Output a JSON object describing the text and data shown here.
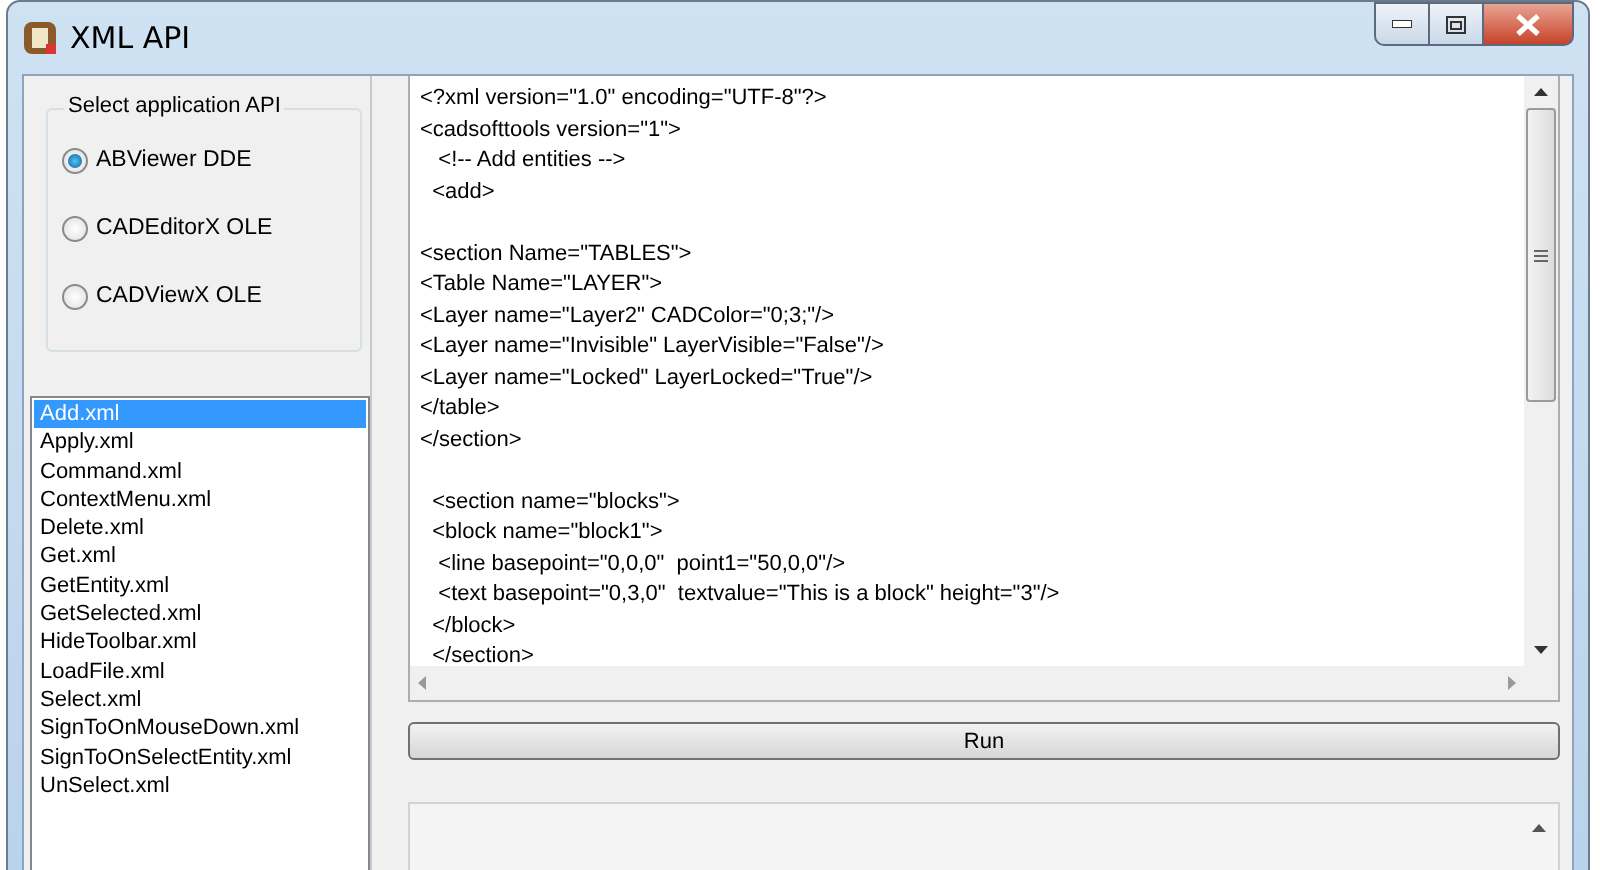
{
  "window": {
    "title": "XML API"
  },
  "api_group": {
    "title": "Select application API",
    "options": [
      {
        "label": "ABViewer DDE",
        "selected": true
      },
      {
        "label": "CADEditorX OLE",
        "selected": false
      },
      {
        "label": "CADViewX OLE",
        "selected": false
      }
    ]
  },
  "files": [
    {
      "label": "Add.xml",
      "selected": true
    },
    {
      "label": "Apply.xml",
      "selected": false
    },
    {
      "label": "Command.xml",
      "selected": false
    },
    {
      "label": "ContextMenu.xml",
      "selected": false
    },
    {
      "label": "Delete.xml",
      "selected": false
    },
    {
      "label": "Get.xml",
      "selected": false
    },
    {
      "label": "GetEntity.xml",
      "selected": false
    },
    {
      "label": "GetSelected.xml",
      "selected": false
    },
    {
      "label": "HideToolbar.xml",
      "selected": false
    },
    {
      "label": "LoadFile.xml",
      "selected": false
    },
    {
      "label": "Select.xml",
      "selected": false
    },
    {
      "label": "SignToOnMouseDown.xml",
      "selected": false
    },
    {
      "label": "SignToOnSelectEntity.xml",
      "selected": false
    },
    {
      "label": "UnSelect.xml",
      "selected": false
    }
  ],
  "editor": {
    "blocks": [
      [
        "<?xml version=\"1.0\" encoding=\"UTF-8\"?>",
        "<cadsofttools version=\"1\">",
        "   <!-- Add entities -->",
        "  <add>"
      ],
      [
        "<section Name=\"TABLES\">",
        "<Table Name=\"LAYER\">",
        "<Layer name=\"Layer2\" CADColor=\"0;3;\"/>",
        "<Layer name=\"Invisible\" LayerVisible=\"False\"/>",
        "<Layer name=\"Locked\" LayerLocked=\"True\"/>",
        "</table>",
        "</section>"
      ],
      [
        "  <section name=\"blocks\">",
        "  <block name=\"block1\">",
        "   <line basepoint=\"0,0,0\"  point1=\"50,0,0\"/>",
        "   <text basepoint=\"0,3,0\"  textvalue=\"This is a block\" height=\"3\"/>",
        "  </block>",
        "  </section>"
      ]
    ]
  },
  "run_button": {
    "label": "Run"
  }
}
